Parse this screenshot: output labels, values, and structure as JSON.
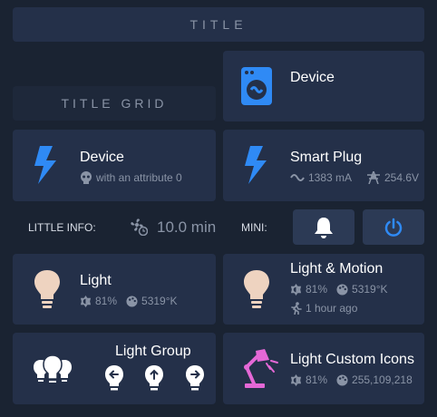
{
  "header": {
    "title": "TITLE"
  },
  "title_grid": {
    "label": "TITLE GRID"
  },
  "device_top": {
    "name": "Device"
  },
  "device_left": {
    "name": "Device",
    "attribute": "with an attribute 0"
  },
  "smart_plug": {
    "name": "Smart Plug",
    "current": "1383 mA",
    "voltage": "254.6V"
  },
  "little_info": {
    "label": "LITTLE INFO:",
    "value": "10.0 min"
  },
  "mini": {
    "label": "MINI:"
  },
  "light": {
    "name": "Light",
    "brightness": "81%",
    "color_temp": "5319°K"
  },
  "light_motion": {
    "name": "Light & Motion",
    "brightness": "81%",
    "color_temp": "5319°K",
    "motion": "1 hour ago"
  },
  "light_group": {
    "name": "Light Group"
  },
  "light_custom": {
    "name": "Light Custom Icons",
    "brightness": "81%",
    "color": "255,109,218"
  },
  "colors": {
    "accent": "#2f8af5",
    "card": "#243049",
    "background": "#1a2332",
    "muted": "#8a94a6",
    "bulb": "#eed3c0",
    "pink": "#e468d6"
  }
}
